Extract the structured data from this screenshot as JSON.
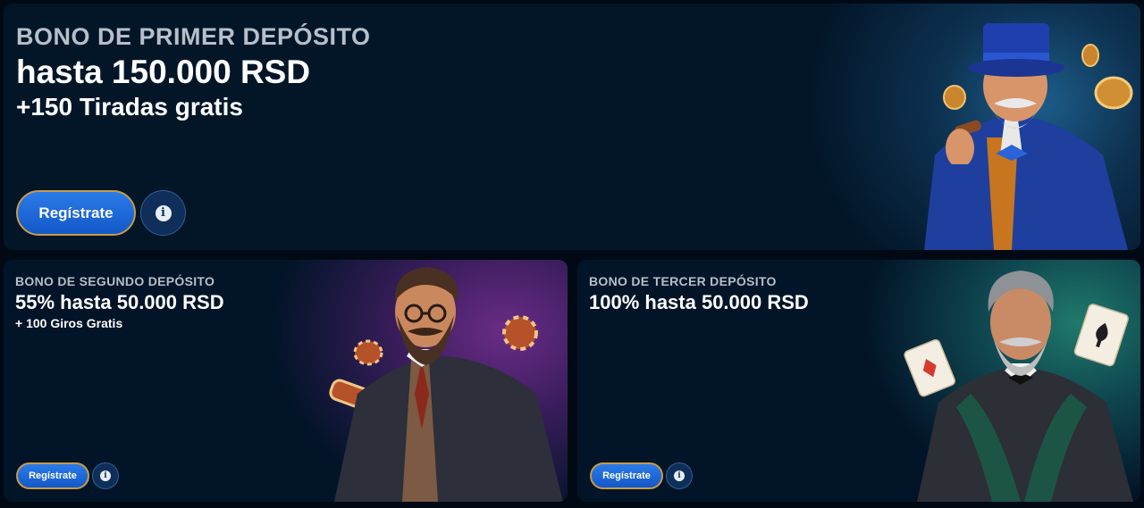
{
  "first_bonus": {
    "eyebrow": "BONO DE PRIMER DEPÓSITO",
    "headline": "hasta 150.000 RSD",
    "sub": "+150 Tiradas gratis",
    "register_label": "Regístrate",
    "info_icon": "info-icon"
  },
  "second_bonus": {
    "eyebrow": "BONO DE SEGUNDO DEPÓSITO",
    "headline": "55% hasta 50.000 RSD",
    "sub": "+ 100 Giros Gratis",
    "register_label": "Regístrate",
    "info_icon": "info-icon"
  },
  "third_bonus": {
    "eyebrow": "BONO DE TERCER DEPÓSITO",
    "headline": "100% hasta 50.000 RSD",
    "register_label": "Regístrate",
    "info_icon": "info-icon"
  },
  "colors": {
    "background": "#010a14",
    "button_blue": "#1458c8",
    "button_border_gold": "#c89a4a",
    "text_white": "#ffffff",
    "eyebrow_gray": "#b6bfca"
  }
}
